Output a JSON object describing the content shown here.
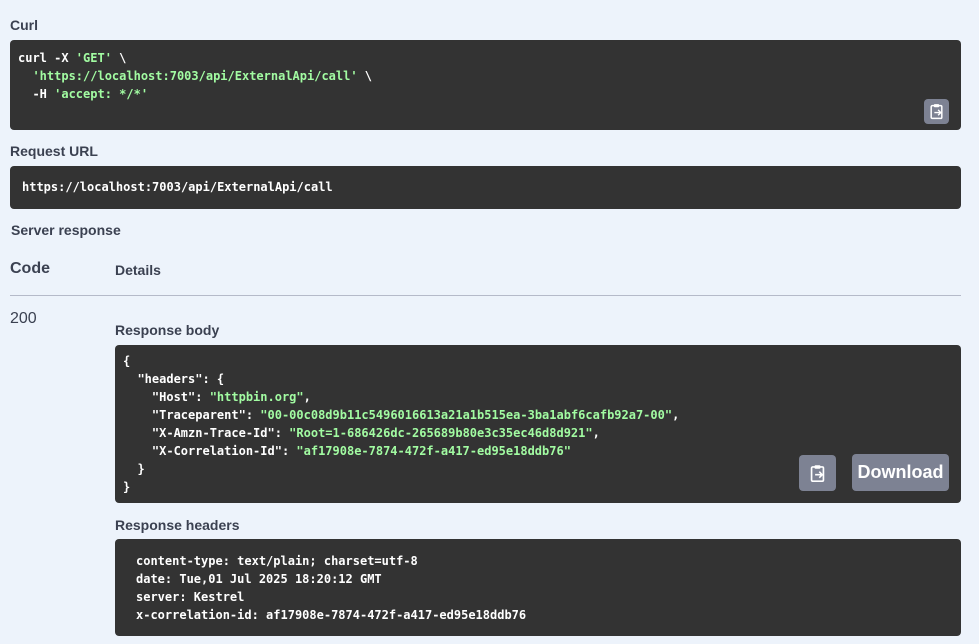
{
  "curl": {
    "label": "Curl",
    "line1_cmd": "curl -X ",
    "line1_method": "'GET'",
    "line1_tail": " \\",
    "line2_indent": "  ",
    "line2_url": "'https://localhost:7003/api/ExternalApi/call'",
    "line2_tail": " \\",
    "line3_indent": "  -H ",
    "line3_header": "'accept: */*'"
  },
  "request_url": {
    "label": "Request URL",
    "value": "https://localhost:7003/api/ExternalApi/call"
  },
  "server_response": {
    "label": "Server response",
    "code_header": "Code",
    "details_header": "Details",
    "code": "200"
  },
  "response_body": {
    "label": "Response body",
    "lines": {
      "l1": "{",
      "l2_key": "  \"headers\": {",
      "l3_key": "    \"Host\": ",
      "l3_val": "\"httpbin.org\"",
      "l3_end": ",",
      "l4_key": "    \"Traceparent\": ",
      "l4_val": "\"00-00c08d9b11c5496016613a21a1b515ea-3ba1abf6cafb92a7-00\"",
      "l4_end": ",",
      "l5_key": "    \"X-Amzn-Trace-Id\": ",
      "l5_val": "\"Root=1-686426dc-265689b80e3c35ec46d8d921\"",
      "l5_end": ",",
      "l6_key": "    \"X-Correlation-Id\": ",
      "l6_val": "\"af17908e-7874-472f-a417-ed95e18ddb76\"",
      "l7": "  }",
      "l8": "}"
    },
    "download_label": "Download"
  },
  "response_headers": {
    "label": "Response headers",
    "lines": [
      "content-type: text/plain; charset=utf-8",
      "date: Tue,01 Jul 2025 18:20:12 GMT",
      "server: Kestrel",
      "x-correlation-id: af17908e-7874-472f-a417-ed95e18ddb76"
    ]
  },
  "icons": {
    "copy": "clipboard-copy-icon"
  }
}
